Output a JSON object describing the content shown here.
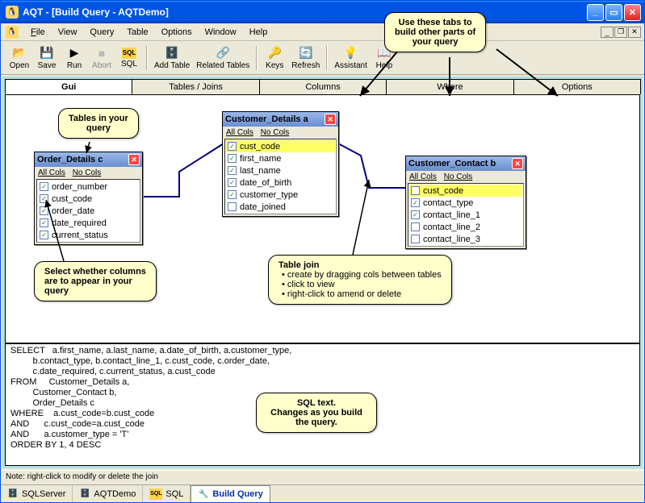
{
  "window": {
    "title": "AQT - [Build Query - AQTDemo]"
  },
  "menus": {
    "file": "File",
    "view": "View",
    "query": "Query",
    "table": "Table",
    "options": "Options",
    "window": "Window",
    "help": "Help"
  },
  "toolbar": {
    "open": "Open",
    "save": "Save",
    "run": "Run",
    "abort": "Abort",
    "sql": "SQL",
    "add_table": "Add Table",
    "related_tables": "Related Tables",
    "keys": "Keys",
    "refresh": "Refresh",
    "assistant": "Assistant",
    "help": "Help"
  },
  "tabs": {
    "gui": "Gui",
    "tables_joins": "Tables / Joins",
    "columns": "Columns",
    "where": "Where",
    "options": "Options"
  },
  "tables": {
    "order_details": {
      "title": "Order_Details c",
      "all_cols": "All Cols",
      "no_cols": "No Cols",
      "cols": [
        {
          "name": "order_number",
          "checked": true
        },
        {
          "name": "cust_code",
          "checked": true
        },
        {
          "name": "order_date",
          "checked": true
        },
        {
          "name": "date_required",
          "checked": true
        },
        {
          "name": "current_status",
          "checked": true
        }
      ]
    },
    "customer_details": {
      "title": "Customer_Details a",
      "all_cols": "All Cols",
      "no_cols": "No Cols",
      "cols": [
        {
          "name": "cust_code",
          "checked": true,
          "hl": true
        },
        {
          "name": "first_name",
          "checked": true
        },
        {
          "name": "last_name",
          "checked": true
        },
        {
          "name": "date_of_birth",
          "checked": true
        },
        {
          "name": "customer_type",
          "checked": true
        },
        {
          "name": "date_joined",
          "checked": false
        }
      ]
    },
    "customer_contact": {
      "title": "Customer_Contact b",
      "all_cols": "All Cols",
      "no_cols": "No Cols",
      "cols": [
        {
          "name": "cust_code",
          "checked": false,
          "hl": true
        },
        {
          "name": "contact_type",
          "checked": true
        },
        {
          "name": "contact_line_1",
          "checked": true
        },
        {
          "name": "contact_line_2",
          "checked": false
        },
        {
          "name": "contact_line_3",
          "checked": false
        }
      ]
    }
  },
  "callouts": {
    "top_tabs": {
      "l1": "Use these tabs to",
      "l2": "build other parts of",
      "l3": "your query"
    },
    "tables_in_query": {
      "l1": "Tables in your",
      "l2": "query"
    },
    "select_cols": {
      "l1": "Select whether columns",
      "l2": "are to appear in your",
      "l3": "query"
    },
    "table_join": {
      "title": "Table join",
      "b1": "create by dragging cols between tables",
      "b2": "click to view",
      "b3": "right-click to amend or delete"
    },
    "sql_text": {
      "l1": "SQL text.",
      "l2": "Changes as you build",
      "l3": "the query."
    }
  },
  "sql": {
    "l1": "SELECT   a.first_name, a.last_name, a.date_of_birth, a.customer_type,",
    "l2": "         b.contact_type, b.contact_line_1, c.cust_code, c.order_date,",
    "l3": "         c.date_required, c.current_status, a.cust_code",
    "l4": "FROM     Customer_Details a,",
    "l5": "         Customer_Contact b,",
    "l6": "         Order_Details c",
    "l7": "WHERE    a.cust_code=b.cust_code",
    "l8": "AND      c.cust_code=a.cust_code",
    "l9": "AND      a.customer_type = 'T'",
    "l10": "ORDER BY 1, 4 DESC"
  },
  "status": {
    "text": "Note: right-click to modify or delete the join"
  },
  "bottom_tabs": {
    "sqlserver": "SQLServer",
    "aqtdemo": "AQTDemo",
    "sql": "SQL",
    "build_query": "Build Query"
  },
  "icons": {
    "check": "✓"
  }
}
